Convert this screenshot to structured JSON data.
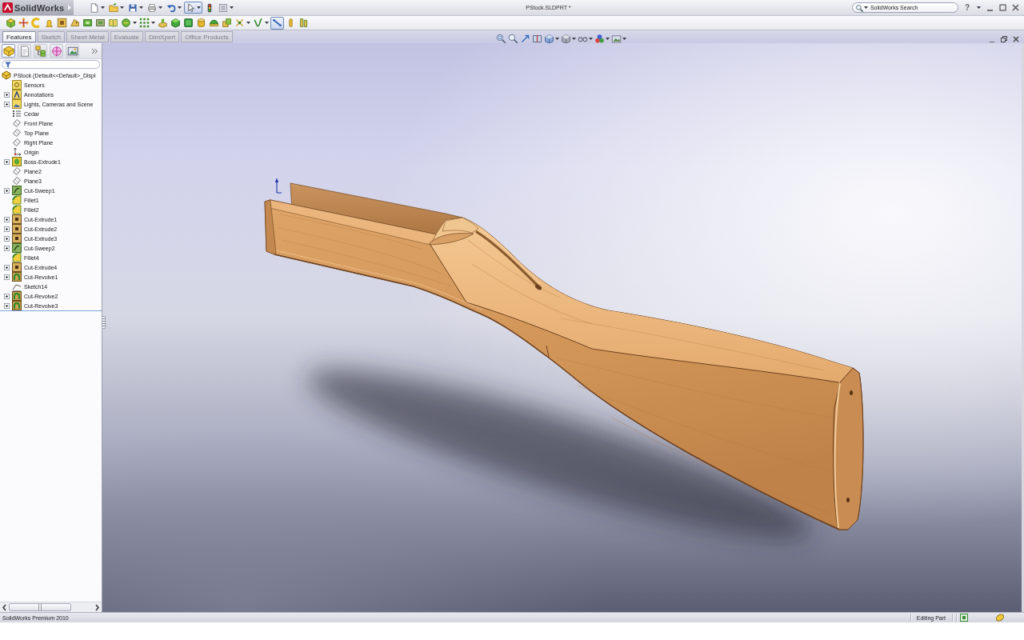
{
  "title_bar": {
    "logo": "SolidWorks",
    "title": "PStock.SLDPRT *",
    "search": {
      "placeholder": "SolidWorks Search"
    },
    "help": "?"
  },
  "quick_access_toolbar": [
    {
      "kind": "new",
      "dropdown": true,
      "pressed": false
    },
    {
      "kind": "open",
      "dropdown": true,
      "pressed": false
    },
    {
      "kind": "save",
      "dropdown": true,
      "pressed": false
    },
    {
      "kind": "print",
      "dropdown": true,
      "pressed": false
    },
    {
      "kind": "undo",
      "dropdown": true,
      "pressed": false
    },
    {
      "kind": "select",
      "dropdown": true,
      "pressed": true
    },
    {
      "kind": "rebuild",
      "dropdown": false,
      "pressed": false
    },
    {
      "kind": "properties",
      "dropdown": true,
      "pressed": false
    }
  ],
  "command_toolbar": [
    {
      "kind": "cube",
      "dropdown": false,
      "pressed": false
    },
    {
      "kind": "arrows",
      "dropdown": false,
      "pressed": false
    },
    {
      "kind": "arc",
      "dropdown": false,
      "pressed": false
    },
    {
      "kind": "bell",
      "dropdown": false,
      "pressed": false
    },
    {
      "kind": "cut-square",
      "dropdown": false,
      "pressed": false
    },
    {
      "kind": "wedge",
      "dropdown": false,
      "pressed": false
    },
    {
      "kind": "green-box",
      "dropdown": false,
      "pressed": false
    },
    {
      "kind": "gray-box",
      "dropdown": false,
      "pressed": false
    },
    {
      "kind": "loft",
      "dropdown": false,
      "pressed": false
    },
    {
      "kind": "sphere",
      "dropdown": true,
      "pressed": false
    },
    {
      "kind": "dots",
      "dropdown": true,
      "pressed": false
    },
    {
      "kind": "block",
      "dropdown": false,
      "pressed": false
    },
    {
      "kind": "green-cube",
      "dropdown": false,
      "pressed": false
    },
    {
      "kind": "green-square",
      "dropdown": false,
      "pressed": false
    },
    {
      "kind": "cylinder",
      "dropdown": false,
      "pressed": false
    },
    {
      "kind": "dome",
      "dropdown": false,
      "pressed": false
    },
    {
      "kind": "stack",
      "dropdown": false,
      "pressed": false
    },
    {
      "kind": "cross",
      "dropdown": true,
      "pressed": false
    },
    {
      "kind": "curve",
      "dropdown": true,
      "pressed": false
    },
    {
      "kind": "line",
      "dropdown": false,
      "pressed": true
    },
    {
      "kind": "pin",
      "dropdown": false,
      "pressed": false
    },
    {
      "kind": "bracket",
      "dropdown": false,
      "pressed": false
    }
  ],
  "tabs": [
    {
      "label": "Features",
      "selected": true
    },
    {
      "label": "Sketch",
      "selected": false
    },
    {
      "label": "Sheet Metal",
      "selected": false
    },
    {
      "label": "Evaluate",
      "selected": false
    },
    {
      "label": "DimXpert",
      "selected": false
    },
    {
      "label": "Office Products",
      "selected": false
    }
  ],
  "feature_manager": {
    "panel_tabs": [
      {
        "kind": "features",
        "selected": true
      },
      {
        "kind": "properties",
        "selected": false
      },
      {
        "kind": "configurations",
        "selected": false
      },
      {
        "kind": "dimxpert",
        "selected": false
      },
      {
        "kind": "display",
        "selected": false
      }
    ],
    "tree": {
      "label": "PStock (Default<<Default>_Displ",
      "kind": "part",
      "children": [
        {
          "label": "Sensors",
          "kind": "sensors",
          "collapsed": false
        },
        {
          "label": "Annotations",
          "kind": "annotations",
          "collapsed": true
        },
        {
          "label": "Lights, Cameras and Scene",
          "kind": "lights",
          "collapsed": true
        },
        {
          "label": "Cedar",
          "kind": "material",
          "collapsed": false
        },
        {
          "label": "Front Plane",
          "kind": "plane",
          "collapsed": false
        },
        {
          "label": "Top Plane",
          "kind": "plane",
          "collapsed": false
        },
        {
          "label": "Right Plane",
          "kind": "plane",
          "collapsed": false
        },
        {
          "label": "Origin",
          "kind": "origin",
          "collapsed": false
        },
        {
          "label": "Boss-Extrude1",
          "kind": "boss-extrude",
          "collapsed": true
        },
        {
          "label": "Plane2",
          "kind": "plane",
          "collapsed": false
        },
        {
          "label": "Plane3",
          "kind": "plane",
          "collapsed": false
        },
        {
          "label": "Cut-Sweep1",
          "kind": "cut-sweep",
          "collapsed": true
        },
        {
          "label": "Fillet1",
          "kind": "fillet",
          "collapsed": false
        },
        {
          "label": "Fillet2",
          "kind": "fillet",
          "collapsed": false
        },
        {
          "label": "Cut-Extrude1",
          "kind": "cut-extrude",
          "collapsed": true
        },
        {
          "label": "Cut-Extrude2",
          "kind": "cut-extrude",
          "collapsed": true
        },
        {
          "label": "Cut-Extrude3",
          "kind": "cut-extrude",
          "collapsed": true
        },
        {
          "label": "Cut-Sweep2",
          "kind": "cut-sweep",
          "collapsed": true
        },
        {
          "label": "Fillet4",
          "kind": "fillet",
          "collapsed": false
        },
        {
          "label": "Cut-Extrude4",
          "kind": "cut-extrude",
          "collapsed": true
        },
        {
          "label": "Cut-Revolve1",
          "kind": "cut-revolve",
          "collapsed": true
        },
        {
          "label": "Sketch14",
          "kind": "sketch",
          "collapsed": false
        },
        {
          "label": "Cut-Revolve2",
          "kind": "cut-revolve",
          "collapsed": true
        },
        {
          "label": "Cut-Revolve3",
          "kind": "cut-revolve",
          "collapsed": true
        }
      ]
    }
  },
  "status_bar": {
    "product": "SolidWorks Premium 2010",
    "mode": "Editing Part"
  }
}
